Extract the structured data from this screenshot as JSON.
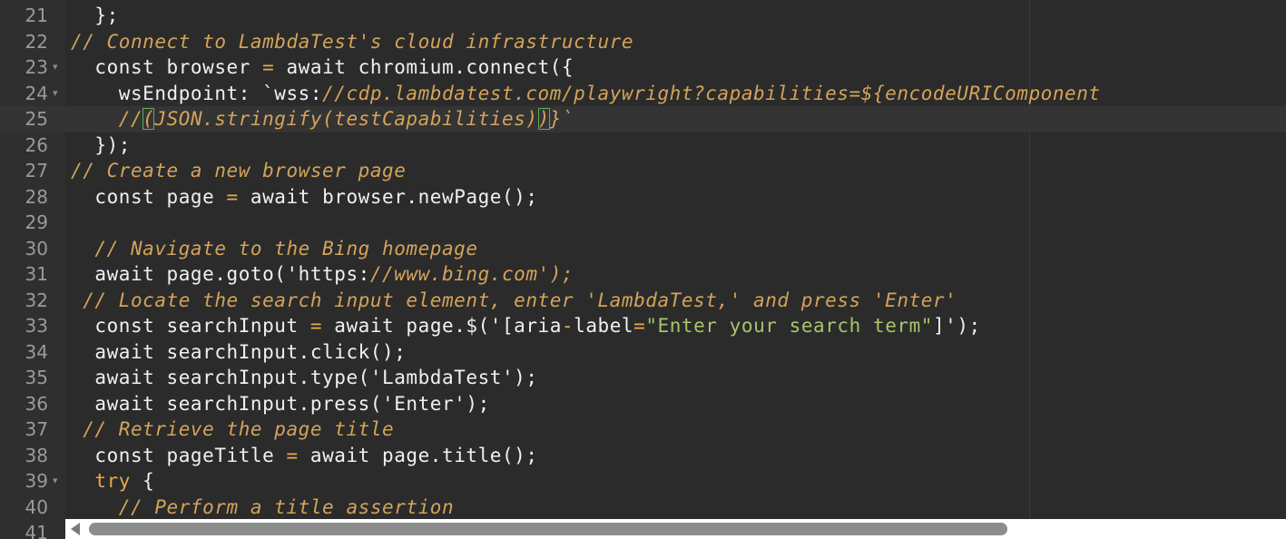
{
  "editor": {
    "active_line": "25",
    "lines": [
      {
        "num": "21",
        "fold": false,
        "tokens": [
          {
            "t": "  };",
            "c": "plain"
          }
        ]
      },
      {
        "num": "22",
        "fold": false,
        "tokens": [
          {
            "t": "// Connect to LambdaTest's cloud infrastructure",
            "c": "comment"
          }
        ]
      },
      {
        "num": "23",
        "fold": true,
        "tokens": [
          {
            "t": "  const browser ",
            "c": "plain"
          },
          {
            "t": "=",
            "c": "op"
          },
          {
            "t": " await chromium.connect({",
            "c": "plain"
          }
        ]
      },
      {
        "num": "24",
        "fold": true,
        "tokens": [
          {
            "t": "    wsEndpoint: `wss:",
            "c": "plain"
          },
          {
            "t": "//cdp.lambdatest.com/playwright?capabilities=${encodeURIComponent",
            "c": "comment"
          }
        ]
      },
      {
        "num": "25",
        "fold": false,
        "tokens": [
          {
            "t": "    //",
            "c": "comment"
          },
          {
            "t": "(",
            "c": "match"
          },
          {
            "t": "JSON.stringify(testCapabilities)",
            "c": "comment"
          },
          {
            "t": ")",
            "c": "match"
          },
          {
            "t": "}`",
            "c": "comment"
          }
        ]
      },
      {
        "num": "26",
        "fold": false,
        "tokens": [
          {
            "t": "  });",
            "c": "plain"
          }
        ]
      },
      {
        "num": "27",
        "fold": false,
        "tokens": [
          {
            "t": "// Create a new browser page",
            "c": "comment"
          }
        ]
      },
      {
        "num": "28",
        "fold": false,
        "tokens": [
          {
            "t": "  const page ",
            "c": "plain"
          },
          {
            "t": "=",
            "c": "op"
          },
          {
            "t": " await browser.newPage();",
            "c": "plain"
          }
        ]
      },
      {
        "num": "29",
        "fold": false,
        "tokens": []
      },
      {
        "num": "30",
        "fold": false,
        "tokens": [
          {
            "t": "  // Navigate to the Bing homepage",
            "c": "comment"
          }
        ]
      },
      {
        "num": "31",
        "fold": false,
        "tokens": [
          {
            "t": "  await page.goto('https:",
            "c": "plain"
          },
          {
            "t": "//www.bing.com');",
            "c": "comment"
          }
        ]
      },
      {
        "num": "32",
        "fold": false,
        "tokens": [
          {
            "t": " // Locate the search input element, enter 'LambdaTest,' and press 'Enter'",
            "c": "comment"
          }
        ]
      },
      {
        "num": "33",
        "fold": false,
        "tokens": [
          {
            "t": "  const searchInput ",
            "c": "plain"
          },
          {
            "t": "=",
            "c": "op"
          },
          {
            "t": " await page.$('[aria",
            "c": "plain"
          },
          {
            "t": "-",
            "c": "op"
          },
          {
            "t": "label",
            "c": "plain"
          },
          {
            "t": "=",
            "c": "op"
          },
          {
            "t": "\"Enter your search term\"",
            "c": "green"
          },
          {
            "t": "]');",
            "c": "plain"
          }
        ]
      },
      {
        "num": "34",
        "fold": false,
        "tokens": [
          {
            "t": "  await searchInput.click();",
            "c": "plain"
          }
        ]
      },
      {
        "num": "35",
        "fold": false,
        "tokens": [
          {
            "t": "  await searchInput.type('LambdaTest');",
            "c": "plain"
          }
        ]
      },
      {
        "num": "36",
        "fold": false,
        "tokens": [
          {
            "t": "  await searchInput.press('Enter');",
            "c": "plain"
          }
        ]
      },
      {
        "num": "37",
        "fold": false,
        "tokens": [
          {
            "t": " // Retrieve the page title",
            "c": "comment"
          }
        ]
      },
      {
        "num": "38",
        "fold": false,
        "tokens": [
          {
            "t": "  const pageTitle ",
            "c": "plain"
          },
          {
            "t": "=",
            "c": "op"
          },
          {
            "t": " await page.title();",
            "c": "plain"
          }
        ]
      },
      {
        "num": "39",
        "fold": true,
        "tokens": [
          {
            "t": "  ",
            "c": "plain"
          },
          {
            "t": "try",
            "c": "keyword"
          },
          {
            "t": " {",
            "c": "plain"
          }
        ]
      },
      {
        "num": "40",
        "fold": false,
        "tokens": [
          {
            "t": "    // Perform a title assertion",
            "c": "comment"
          }
        ]
      },
      {
        "num": "41",
        "fold": false,
        "tokens": []
      }
    ]
  },
  "icons": {
    "fold_marker": "chevron-down-icon",
    "scroll_left": "arrow-left-icon"
  },
  "colors": {
    "background": "#2b2b2b",
    "comment": "#d4a35a",
    "operator": "#e8a94e",
    "string_green": "#a8c46a",
    "text": "#f0f0f0"
  }
}
